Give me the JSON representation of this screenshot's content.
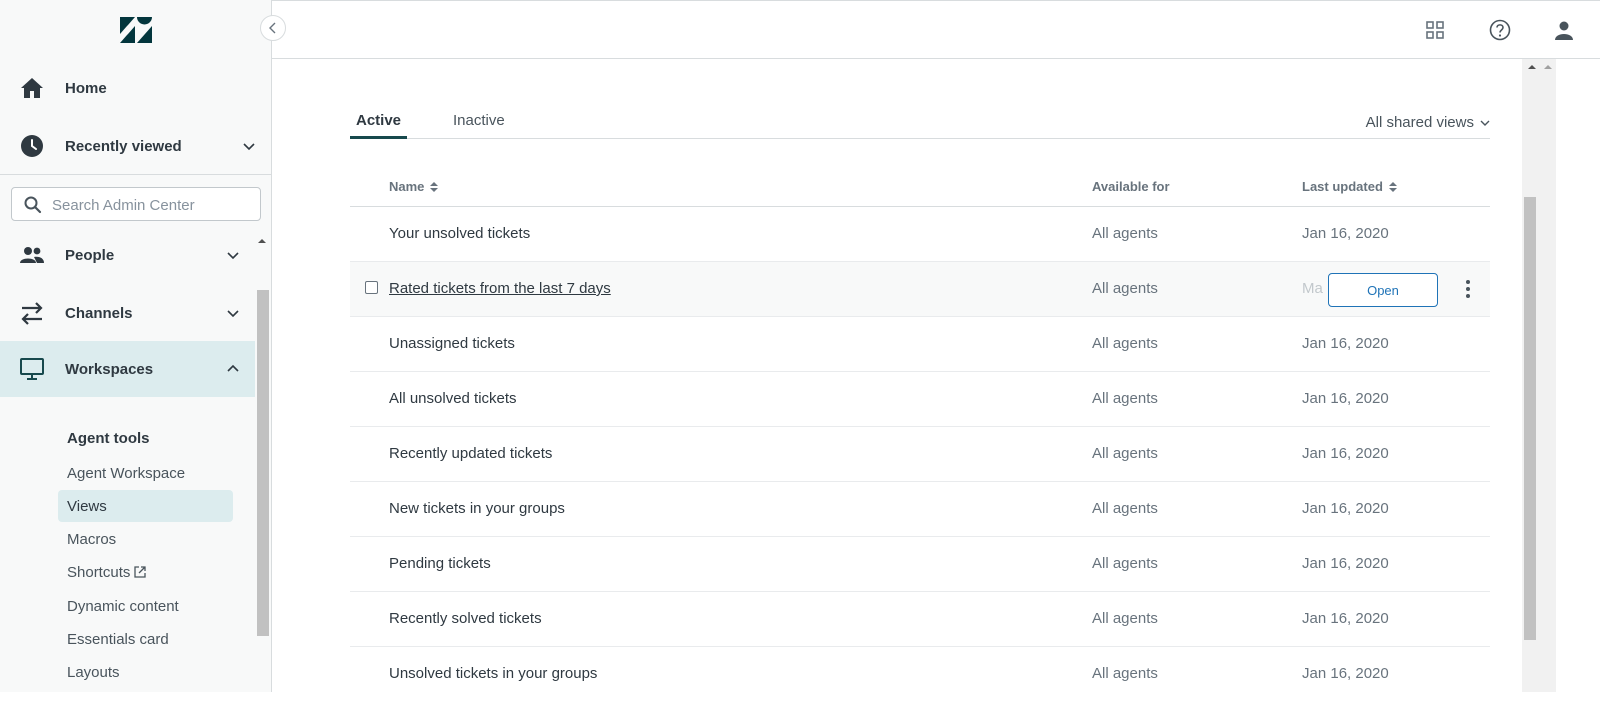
{
  "sidebar": {
    "nav": [
      {
        "label": "Home"
      },
      {
        "label": "Recently viewed"
      },
      {
        "label": "People"
      },
      {
        "label": "Channels"
      },
      {
        "label": "Workspaces"
      }
    ],
    "search_placeholder": "Search Admin Center",
    "section_heading": "Agent tools",
    "sub_items": [
      {
        "label": "Agent Workspace"
      },
      {
        "label": "Views"
      },
      {
        "label": "Macros"
      },
      {
        "label": "Shortcuts"
      },
      {
        "label": "Dynamic content"
      },
      {
        "label": "Essentials card"
      },
      {
        "label": "Layouts"
      }
    ]
  },
  "tabs": {
    "active": "Active",
    "inactive": "Inactive",
    "filter": "All shared views"
  },
  "table": {
    "headers": {
      "name": "Name",
      "available": "Available for",
      "updated": "Last updated"
    },
    "rows": [
      {
        "name": "Your unsolved tickets",
        "available": "All agents",
        "updated": "Jan 16, 2020"
      },
      {
        "name": "Rated tickets from the last 7 days",
        "available": "All agents",
        "updated": "Ma"
      },
      {
        "name": "Unassigned tickets",
        "available": "All agents",
        "updated": "Jan 16, 2020"
      },
      {
        "name": "All unsolved tickets",
        "available": "All agents",
        "updated": "Jan 16, 2020"
      },
      {
        "name": "Recently updated tickets",
        "available": "All agents",
        "updated": "Jan 16, 2020"
      },
      {
        "name": "New tickets in your groups",
        "available": "All agents",
        "updated": "Jan 16, 2020"
      },
      {
        "name": "Pending tickets",
        "available": "All agents",
        "updated": "Jan 16, 2020"
      },
      {
        "name": "Recently solved tickets",
        "available": "All agents",
        "updated": "Jan 16, 2020"
      },
      {
        "name": "Unsolved tickets in your groups",
        "available": "All agents",
        "updated": "Jan 16, 2020"
      }
    ],
    "open_button": "Open"
  },
  "colors": {
    "accent": "#17494d",
    "active_bg": "#dcecee",
    "link_blue": "#1f73b7"
  }
}
